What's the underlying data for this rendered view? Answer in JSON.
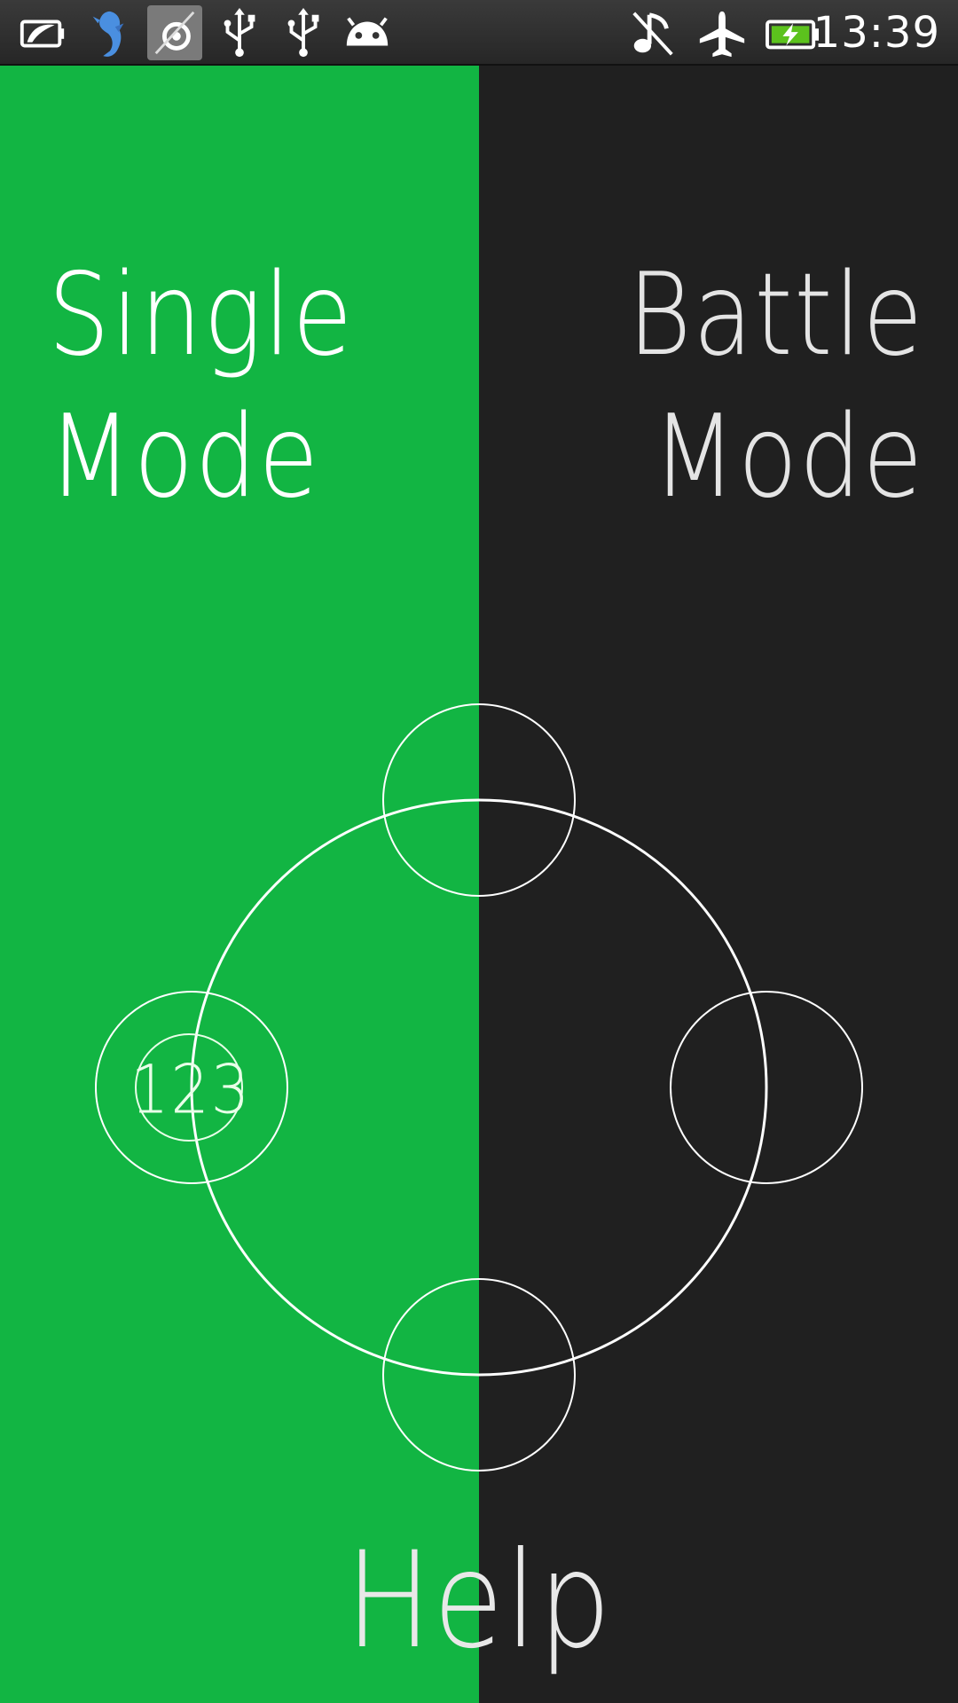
{
  "status_bar": {
    "time": "13:39",
    "left_icons": [
      "battery-saver-icon",
      "dolphin-app-icon",
      "app-notification-icon",
      "usb-icon",
      "usb-icon",
      "android-debug-icon"
    ],
    "right_icons": [
      "music-off-icon",
      "airplane-mode-icon",
      "battery-charging-icon"
    ]
  },
  "menu": {
    "single_mode": {
      "line1": "Single",
      "line2": "Mode"
    },
    "battle_mode": {
      "line1": "Battle",
      "line2": "Mode"
    },
    "help": "Help",
    "badge": "123"
  },
  "colors": {
    "left_panel": "#12b543",
    "right_panel": "#202020",
    "stroke": "#ffffff",
    "battery_fill": "#5cc21d"
  }
}
